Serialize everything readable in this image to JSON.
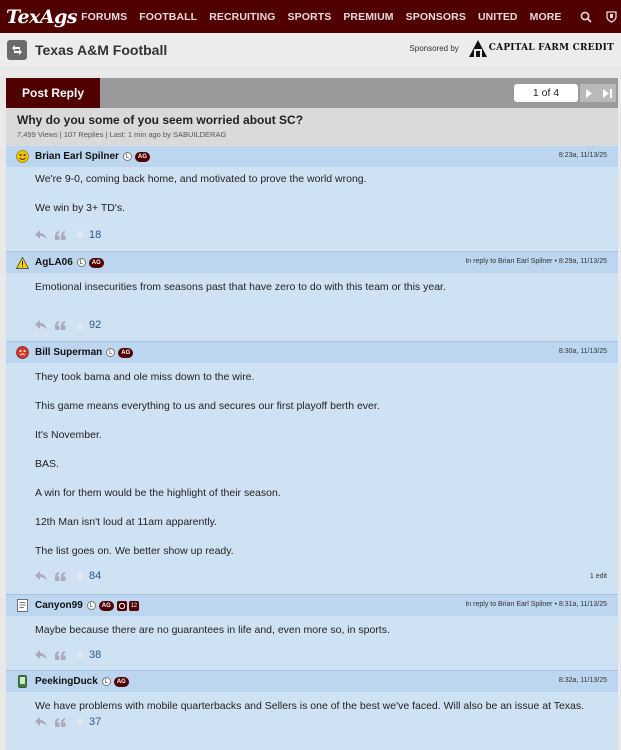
{
  "site": {
    "logo": "TexAgs",
    "nav": [
      "FORUMS",
      "FOOTBALL",
      "RECRUITING",
      "SPORTS",
      "PREMIUM",
      "SPONSORS",
      "UNITED",
      "MORE"
    ]
  },
  "forum": {
    "title": "Texas A&M Football",
    "sponsored_by": "Sponsored by",
    "sponsor_name": "CAPITAL FARM CREDIT"
  },
  "toolbar": {
    "post_reply": "Post Reply",
    "page_indicator": "1 of 4"
  },
  "thread": {
    "title": "Why do you some of you seem worried about SC?",
    "meta": "7,499 Views | 107 Replies | Last: 1 min ago by SABUILDERAG"
  },
  "badges": {
    "l": "L",
    "ag": "AG"
  },
  "posts": [
    {
      "username": "Brian Earl Spilner",
      "time": "8:23a, 11/13/25",
      "lines": [
        "We're 9-0, coming back home, and motivated to prove the world wrong.",
        "We win by 3+ TD's."
      ],
      "stars": "18",
      "avatar_icon": "smiley-face-icon"
    },
    {
      "username": "AgLA06",
      "time": "In reply to Brian Earl Spilner • 8:29a, 11/13/25",
      "lines": [
        "Emotional insecurities from seasons past that have zero to do with this team or this year."
      ],
      "stars": "92",
      "avatar_icon": "warning-sign-icon"
    },
    {
      "username": "Bill Superman",
      "time": "8:30a, 11/13/25",
      "lines": [
        "They took bama and ole miss down to the wire.",
        "This game means everything to us and secures our first playoff berth ever.",
        "It's November.",
        "BAS.",
        "A win for them would be the highlight of their season.",
        "12th Man isn't loud at 11am apparently.",
        "The list goes on. We better show up ready."
      ],
      "stars": "84",
      "edit": "1 edit",
      "avatar_icon": "red-face-icon"
    },
    {
      "username": "Canyon99",
      "time": "In reply to Brian Earl Spilner • 8:31a, 11/13/25",
      "lines": [
        "Maybe because there are no guarantees in life and, even more so, in sports."
      ],
      "stars": "38",
      "avatar_icon": "document-icon",
      "extra_badge": "12"
    },
    {
      "username": "PeekingDuck",
      "time": "8:32a, 11/13/25",
      "lines": [
        "We have problems with mobile quarterbacks and Sellers is one of the best we've faced. Will also be an issue at Texas."
      ],
      "stars": "37",
      "avatar_icon": "phone-icon"
    }
  ]
}
